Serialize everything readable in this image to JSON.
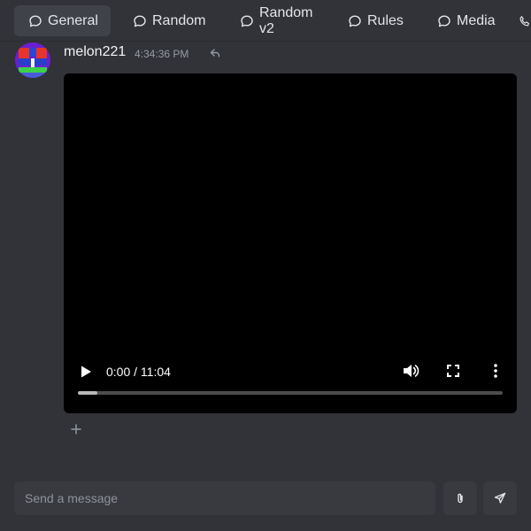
{
  "tabs": [
    {
      "label": "General",
      "active": true
    },
    {
      "label": "Random",
      "active": false
    },
    {
      "label": "Random v2",
      "active": false
    },
    {
      "label": "Rules",
      "active": false
    },
    {
      "label": "Media",
      "active": false
    }
  ],
  "icons": {
    "tab": "chat-bubble-icon",
    "overflow_tab": "phone-icon",
    "reply": "reply-icon",
    "add_reaction": "plus-icon",
    "attach": "paperclip-icon",
    "send": "send-icon"
  },
  "message": {
    "username": "melon221",
    "timestamp": "4:34:36 PM",
    "video": {
      "current_time": "0:00",
      "duration": "11:04",
      "time_display": "0:00 / 11:04",
      "buffered_fraction": 0.045
    }
  },
  "composer": {
    "placeholder": "Send a message"
  },
  "colors": {
    "background": "#313338",
    "tab_active": "#404249",
    "input_bg": "#383a40",
    "video_bg": "#000000"
  }
}
